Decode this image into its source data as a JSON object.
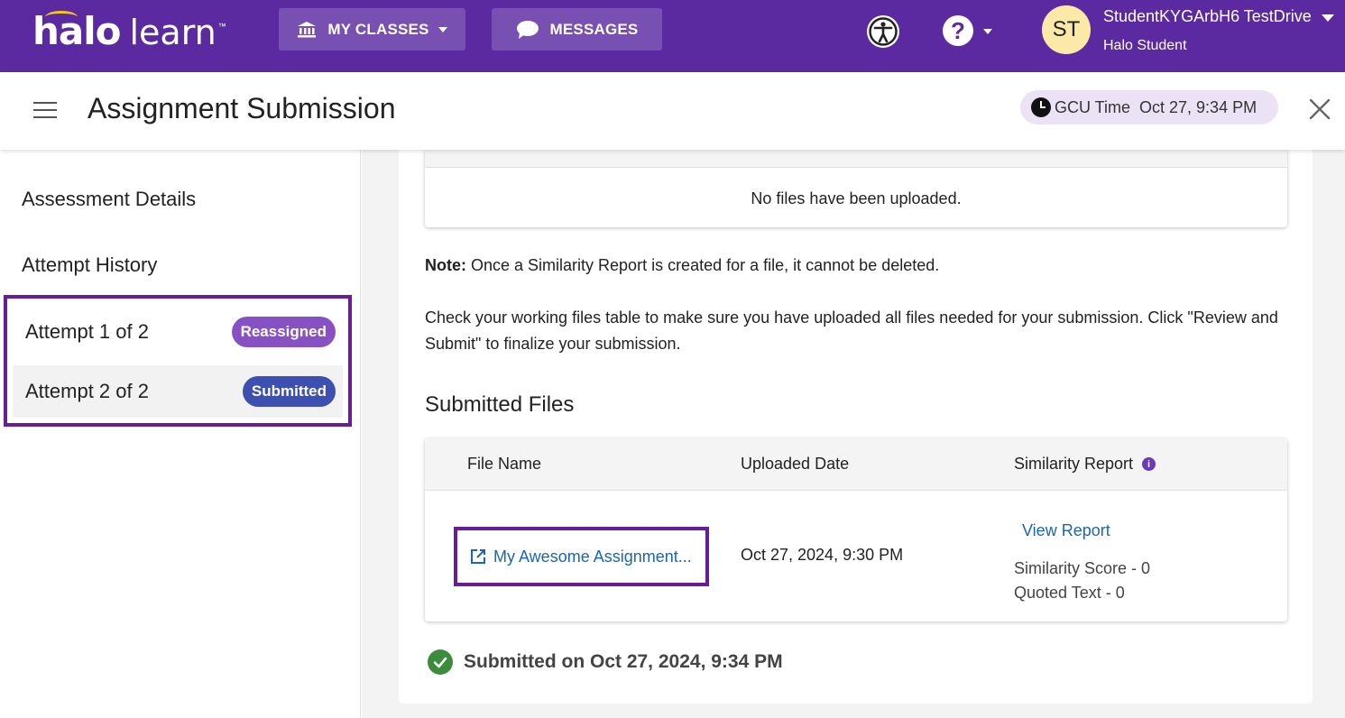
{
  "topbar": {
    "logo_halo": "halo",
    "logo_learn": "learn",
    "logo_tm": "™",
    "my_classes_label": "MY CLASSES",
    "messages_label": "MESSAGES",
    "help_symbol": "?",
    "user_initials": "ST",
    "user_name": "StudentKYGArbH6 TestDrive",
    "user_role": "Halo Student",
    "icons": {
      "classes": "institution-icon",
      "messages": "chat-bubble-icon",
      "accessibility": "accessibility-icon",
      "help": "help-icon"
    },
    "bar_color": "#5b2aa0"
  },
  "header": {
    "title": "Assignment Submission",
    "gcu_time_label": "GCU Time",
    "gcu_time_value": "Oct 27, 9:34 PM"
  },
  "sidebar": {
    "items": [
      {
        "label": "Assessment Details"
      },
      {
        "label": "Attempt History"
      }
    ],
    "attempts": [
      {
        "label": "Attempt 1 of 2",
        "badge": "Reassigned",
        "badge_color": "#8751c4"
      },
      {
        "label": "Attempt 2 of 2",
        "badge": "Submitted",
        "badge_color": "#3d4fb0"
      }
    ]
  },
  "main": {
    "working_files_empty": "No files have been uploaded.",
    "note_label": "Note:",
    "note_text": " Once a Similarity Report is created for a file, it cannot be deleted.",
    "instructions": "Check your working files table to make sure you have uploaded all files needed for your submission. Click \"Review and Submit\" to finalize your submission.",
    "submitted_heading": "Submitted Files",
    "submitted_table": {
      "headers": [
        "File Name",
        "Uploaded Date",
        "Similarity Report"
      ],
      "info_symbol": "i",
      "rows": [
        {
          "file_name": "My Awesome Assignment...",
          "uploaded_date": "Oct 27, 2024, 9:30 PM",
          "view_report": "View Report",
          "similarity_score": "Similarity Score - 0",
          "quoted_text": "Quoted Text - 0"
        }
      ]
    },
    "status_text": "Submitted on Oct 27, 2024, 9:34 PM",
    "status_color": "#3c8c3c",
    "link_color": "#1a66b3",
    "highlight_color": "#6a1b9a"
  }
}
